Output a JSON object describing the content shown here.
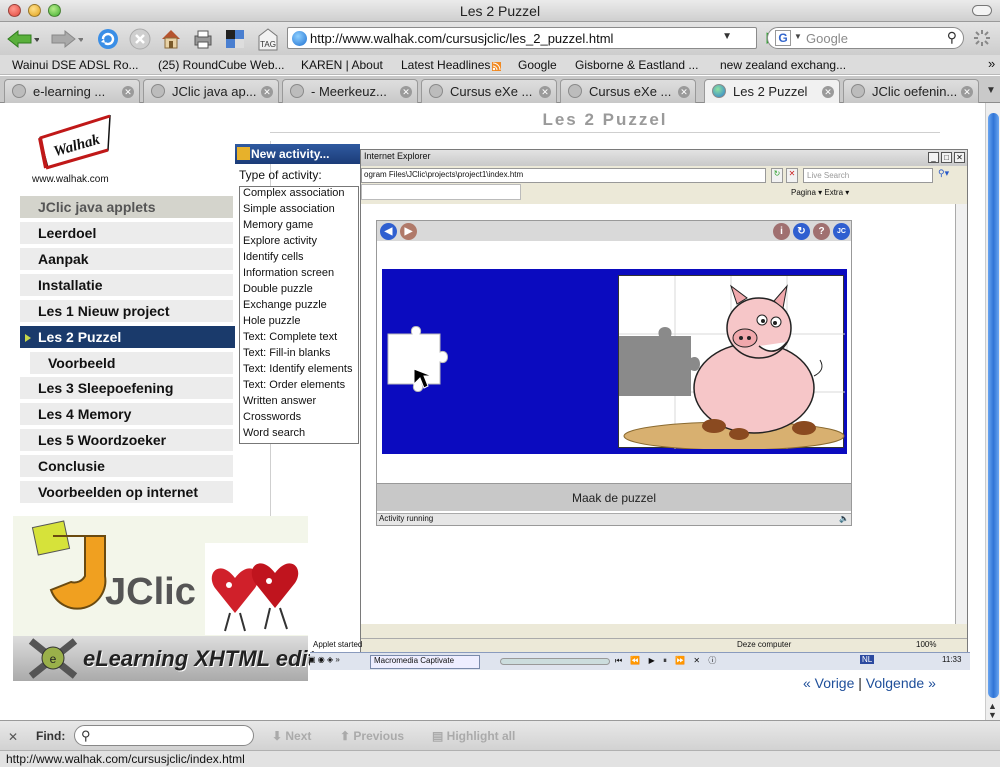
{
  "window": {
    "title": "Les 2 Puzzel"
  },
  "nav": {
    "url": "http://www.walhak.com/cursusjclic/les_2_puzzel.html",
    "search_placeholder": "Google",
    "tag_label": "TAG"
  },
  "bookmarks": [
    "Wainui DSE ADSL Ro...",
    "(25) RoundCube Web...",
    "KAREN | About",
    "Latest Headlines",
    "Google",
    "Gisborne & Eastland ...",
    "new zealand exchang..."
  ],
  "tabs": [
    "e-learning ...",
    "JClic java ap...",
    "- Meerkeuz...",
    "Cursus eXe ...",
    "Cursus eXe ...",
    "Les 2 Puzzel",
    "JClic oefenin..."
  ],
  "page": {
    "title": "Les 2 Puzzel",
    "logo_url": "www.walhak.com",
    "menu": [
      "JClic java applets",
      "Leerdoel",
      "Aanpak",
      "Installatie",
      "Les 1 Nieuw project",
      "Les 2 Puzzel",
      "Voorbeeld",
      "Les 3 Sleepoefening",
      "Les 4 Memory",
      "Les 5 Woordzoeker",
      "Conclusie",
      "Voorbeelden op internet"
    ],
    "jclic_logo_text": "JClic",
    "exe_banner": "eLearning XHTML editor",
    "prev_label": "« Vorige",
    "sep": "|",
    "next_label": "Volgende »"
  },
  "screenshot": {
    "new_activity_title": "New activity...",
    "type_label": "Type of activity:",
    "activity_types": [
      "Complex association",
      "Simple association",
      "Memory game",
      "Explore activity",
      "Identify cells",
      "Information screen",
      "Double puzzle",
      "Exchange puzzle",
      "Hole puzzle",
      "Text: Complete text",
      "Text: Fill-in blanks",
      "Text: Identify elements",
      "Text: Order elements",
      "Written answer",
      "Crosswords",
      "Word search"
    ],
    "ie_title": "Internet Explorer",
    "ie_address": "ogram Files\\JClic\\projects\\project1\\index.htm",
    "ie_live_search": "Live Search",
    "ie_toolbar": "Pagina ▾  Extra ▾",
    "applet_message": "Maak de puzzel",
    "applet_status": "Activity running",
    "ie_status_left": "Applet started",
    "ie_status_zone": "Deze computer",
    "ie_zoom": "100%",
    "taskbar_app": "Macromedia Captivate",
    "taskbar_lang": "NL",
    "taskbar_time": "11:33"
  },
  "findbar": {
    "label": "Find:",
    "next": "Next",
    "previous": "Previous",
    "highlight": "Highlight all"
  },
  "status": {
    "text": "http://www.walhak.com/cursusjclic/index.html"
  }
}
